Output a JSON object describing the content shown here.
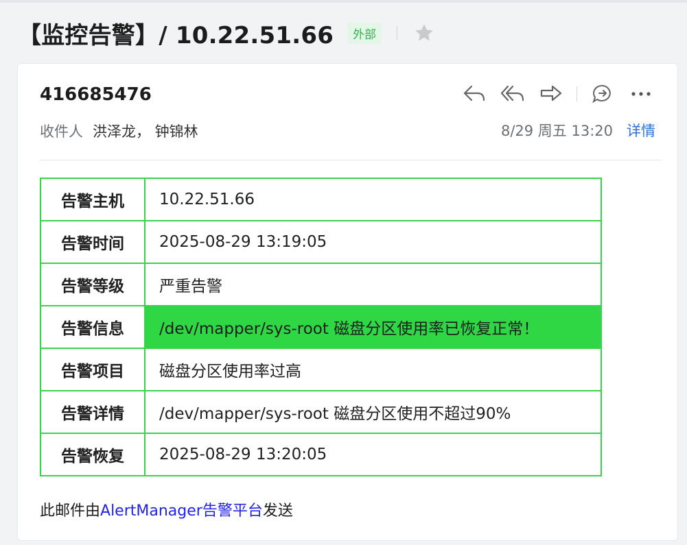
{
  "subject": "【监控告警】/ 10.22.51.66",
  "tag": "外部",
  "sender": "416685476",
  "recipients_label": "收件人",
  "recipients": "洪泽龙， 钟锦林",
  "date": "8/29 周五 13:20",
  "details_link": "详情",
  "actions": [
    "reply",
    "reply-all",
    "forward",
    "comment",
    "more"
  ],
  "colors": {
    "table_border": "#3ad24a",
    "highlight": "#2fd745",
    "link": "#2a6fdb",
    "footer_link": "#2222e8",
    "tag_text": "#36b04d"
  },
  "alert_table": [
    {
      "key": "告警主机",
      "value": "10.22.51.66"
    },
    {
      "key": "告警时间",
      "value": "2025-08-29 13:19:05"
    },
    {
      "key": "告警等级",
      "value": "严重告警"
    },
    {
      "key": "告警信息",
      "value": "/dev/mapper/sys-root 磁盘分区使用率已恢复正常！"
    },
    {
      "key": "告警项目",
      "value": "磁盘分区使用率过高"
    },
    {
      "key": "告警详情",
      "value": "/dev/mapper/sys-root 磁盘分区使用不超过90%"
    },
    {
      "key": "告警恢复",
      "value": "2025-08-29 13:20:05"
    }
  ],
  "footer": {
    "prefix": "此邮件由",
    "link": "AlertManager告警平台",
    "suffix": "发送"
  }
}
